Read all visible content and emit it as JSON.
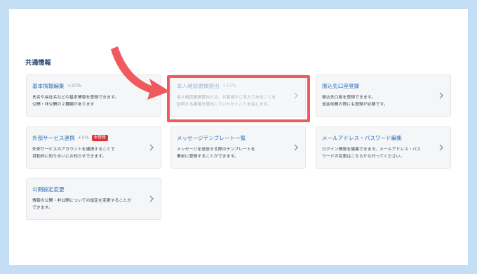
{
  "section": {
    "title": "共通情報"
  },
  "cards": [
    {
      "title": "基本情報編集",
      "bonus": "+20%",
      "desc_lines": [
        "氏名や会社名などの基本情報を登録できます。",
        "公開・非公開の２種類があります"
      ]
    },
    {
      "title": "本人確認書類提出",
      "bonus": "+10%",
      "desc_lines": [
        "本人確認書類提出とは、お客様がご本人であることを",
        "証明する書類を提出していただくことを指します。"
      ]
    },
    {
      "title": "振込先口座登録",
      "bonus": "",
      "desc_lines": [
        "振込先口座を登録できます。",
        "送金依頼の際にも登録が必要です。"
      ]
    },
    {
      "title": "外部サービス連携",
      "bonus": "+5%",
      "badge": "未登録",
      "desc_lines": [
        "外部サービスのアカウントを連携することで",
        "目動的に知り合いにお知らせできます。"
      ]
    },
    {
      "title": "メッセージテンプレート一覧",
      "bonus": "",
      "desc_lines": [
        "メッセージを送信する際のテンプレートを",
        "事前に登録することができます。"
      ]
    },
    {
      "title": "メールアドレス・パスワード編集",
      "bonus": "",
      "desc_lines": [
        "ログイン情報を編集できます。メールアドレス・パス",
        "ワードの変更はこちらから行ってください。"
      ]
    },
    {
      "title": "公開設定変更",
      "bonus": "",
      "desc_lines": [
        "情報の公開・非公開についての設定を変更することが",
        "できます。"
      ]
    }
  ],
  "colors": {
    "outer_background": "#c4def5",
    "card_title": "#2f6fb7",
    "highlight": "#f05a5e",
    "badge": "#e0333a",
    "arrow": "#f05a5e"
  },
  "icons": {
    "card_chevron": "chevron-right-icon",
    "annotation_arrow": "curved-arrow-icon"
  }
}
